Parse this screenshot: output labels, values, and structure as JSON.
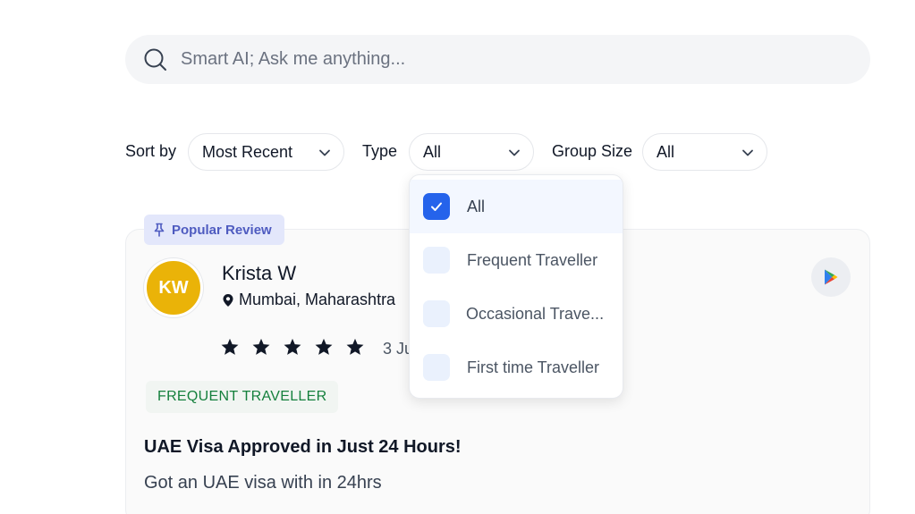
{
  "search": {
    "placeholder": "Smart AI; Ask me anything...",
    "value": ""
  },
  "filters": {
    "sort": {
      "label": "Sort by",
      "value": "Most Recent"
    },
    "type": {
      "label": "Type",
      "value": "All"
    },
    "group_size": {
      "label": "Group Size",
      "value": "All"
    }
  },
  "type_dropdown": {
    "options": [
      {
        "label": "All",
        "checked": true
      },
      {
        "label": "Frequent Traveller",
        "checked": false
      },
      {
        "label": "Occasional Trave...",
        "checked": false
      },
      {
        "label": "First time Traveller",
        "checked": false
      }
    ]
  },
  "review": {
    "badge": "Popular Review",
    "avatar_initials": "KW",
    "name": "Krista W",
    "location": "Mumbai, Maharashtra",
    "rating": 5,
    "date_partial": "3 Ju",
    "traveller_tag": "FREQUENT TRAVELLER",
    "title": "UAE Visa Approved in Just 24 Hours!",
    "body": "Got an UAE visa with in 24hrs"
  },
  "colors": {
    "avatar_bg": "#eab308",
    "badge_bg": "#e3e7fb",
    "badge_text": "#4e5bc0",
    "tag_text": "#15803d",
    "checkbox_checked": "#2563eb"
  }
}
